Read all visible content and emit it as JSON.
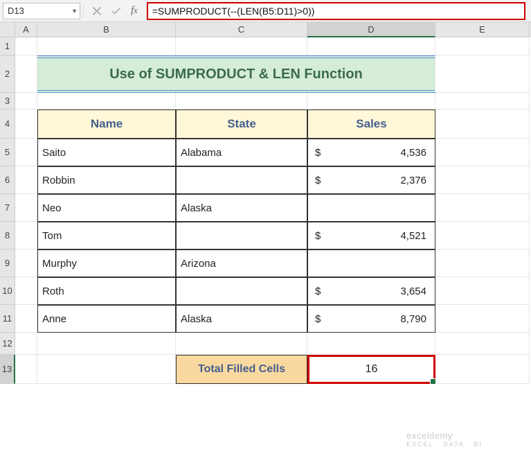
{
  "name_box": "D13",
  "formula": "=SUMPRODUCT(--(LEN(B5:D11)>0))",
  "columns": [
    "A",
    "B",
    "C",
    "D",
    "E"
  ],
  "selected_col": "D",
  "row_numbers": [
    1,
    2,
    3,
    4,
    5,
    6,
    7,
    8,
    9,
    10,
    11,
    12,
    13
  ],
  "selected_row": 13,
  "title": "Use of SUMPRODUCT & LEN Function",
  "headers": {
    "name": "Name",
    "state": "State",
    "sales": "Sales"
  },
  "data": [
    {
      "name": "Saito",
      "state": "Alabama",
      "sales": "4,536"
    },
    {
      "name": "Robbin",
      "state": "",
      "sales": "2,376"
    },
    {
      "name": "Neo",
      "state": "Alaska",
      "sales": ""
    },
    {
      "name": "Tom",
      "state": "",
      "sales": "4,521"
    },
    {
      "name": "Murphy",
      "state": "Arizona",
      "sales": ""
    },
    {
      "name": "Roth",
      "state": "",
      "sales": "3,654"
    },
    {
      "name": "Anne",
      "state": "Alaska",
      "sales": "8,790"
    }
  ],
  "currency_symbol": "$",
  "total_label": "Total Filled Cells",
  "total_value": "16",
  "watermark": {
    "line1": "exceldemy",
    "line2": "EXCEL · DATA · BI"
  }
}
